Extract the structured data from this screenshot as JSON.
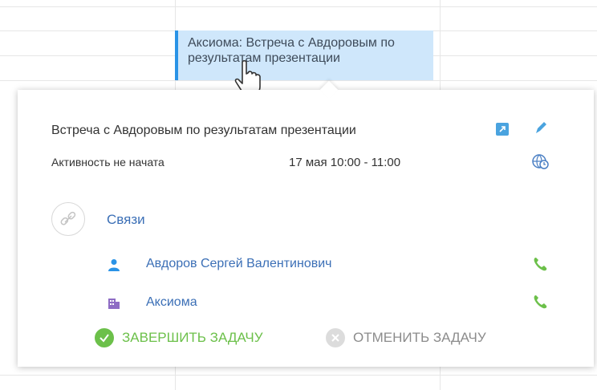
{
  "calendar": {
    "event_text": "Аксиома: Встреча с Авдоровым по результатам презентации"
  },
  "popup": {
    "title": "Встреча с Авдоровым по результатам презентации",
    "status": "Активность не начата",
    "time": "17 мая 10:00 - 11:00",
    "links_label": "Связи",
    "contacts": [
      {
        "name": "Авдоров Сергей Валентинович",
        "icon": "person-icon"
      },
      {
        "name": "Аксиома",
        "icon": "company-icon"
      }
    ],
    "complete_label": "ЗАВЕРШИТЬ ЗАДАЧУ",
    "cancel_label": "ОТМЕНИТЬ ЗАДАЧУ"
  },
  "colors": {
    "accent_blue": "#2a93e6",
    "link_blue": "#3b6fb6",
    "green": "#6cc04a",
    "grey": "#c4c4c4"
  }
}
